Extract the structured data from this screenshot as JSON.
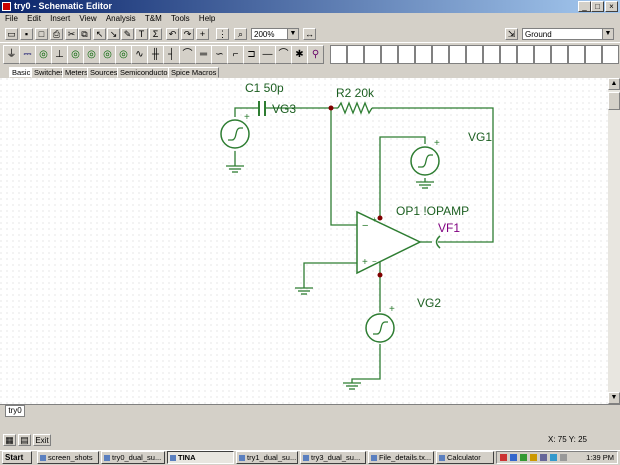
{
  "window": {
    "title": "try0 - Schematic Editor"
  },
  "menu": [
    "File",
    "Edit",
    "Insert",
    "View",
    "Analysis",
    "T&M",
    "Tools",
    "Help"
  ],
  "toolbar": {
    "zoom": "200%",
    "component_select": "Ground"
  },
  "component_tabs": [
    "Basic",
    "Switches",
    "Meters",
    "Sources",
    "Semiconductors",
    "Spice Macros"
  ],
  "schematic": {
    "labels": {
      "c1": "C1 50p",
      "r2": "R2 20k",
      "vg3": "VG3",
      "vg1": "VG1",
      "op1": "OP1 !OPAMP",
      "vf1": "VF1",
      "vg2": "VG2"
    }
  },
  "sheet_tab": "try0",
  "status": {
    "coordinates": "X: 75  Y: 25"
  },
  "taskbar": {
    "start": "Start",
    "tasks": [
      "screen_shots",
      "try0_dual_su...",
      "TINA",
      "try1_dual_su...",
      "try3_dual_su...",
      "File_details.tx...",
      "Calculator"
    ],
    "clock": "1:39 PM"
  },
  "colors": {
    "wire": "#2e7d32",
    "component": "#2e7d32",
    "label": "#1b5e20",
    "vf_label": "#800080",
    "junction": "#800000",
    "titlebar": "#0a246a"
  }
}
